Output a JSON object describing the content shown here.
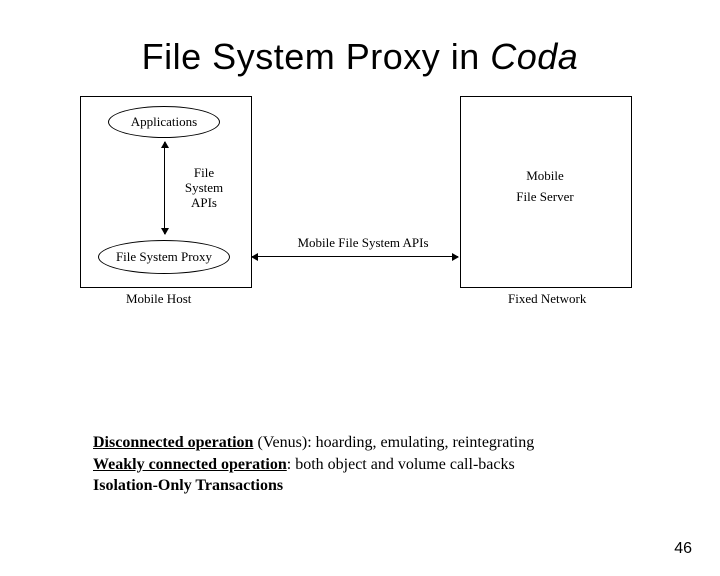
{
  "title": {
    "pre": "File System Proxy in ",
    "italic": "Coda"
  },
  "diagram": {
    "left_box_caption": "Mobile Host",
    "right_box_caption": "Fixed Network",
    "applications": "Applications",
    "file_system_apis_line1": "File",
    "file_system_apis_line2": "System",
    "file_system_apis_line3": "APIs",
    "proxy": "File System Proxy",
    "mobile_apis": "Mobile File System APIs",
    "server_line1": "Mobile",
    "server_line2": "File Server"
  },
  "notes": {
    "l1_term": "Disconnected operation",
    "l1_rest": " (Venus): hoarding, emulating, reintegrating",
    "l2_term": "Weakly connected operation",
    "l2_rest": ": both object and volume call-backs",
    "l3_term": "Isolation-Only Transactions"
  },
  "page_number": "46"
}
